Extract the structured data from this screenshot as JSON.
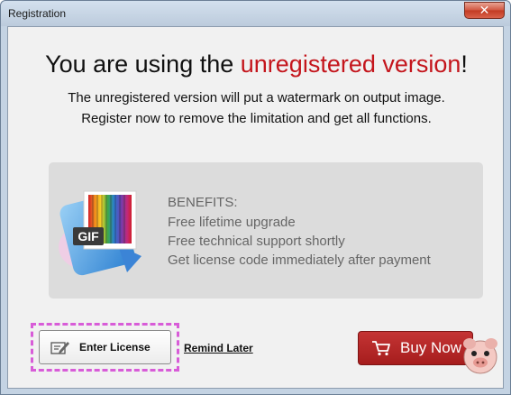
{
  "window": {
    "title": "Registration",
    "close_glyph": "✕"
  },
  "headline": {
    "prefix": "You are using the ",
    "highlight": "unregistered version",
    "suffix": "!"
  },
  "description": {
    "line1": "The unregistered version will put a watermark on output image.",
    "line2": "Register now to remove the limitation and get all functions."
  },
  "benefits": {
    "heading": "BENEFITS:",
    "items": [
      "Free lifetime upgrade",
      "Free technical support shortly",
      "Get license code immediately after payment"
    ],
    "icon_badge": "GIF",
    "icon": "gif-app-icon"
  },
  "actions": {
    "enter_license_label": "Enter License",
    "enter_license_icon": "pen-icon",
    "remind_later_label": "Remind Later",
    "buy_now_label": "Buy Now",
    "buy_now_icon": "cart-icon"
  },
  "colors": {
    "highlight_red": "#c4151c",
    "buy_button": "#b52626",
    "focus_dash": "#d85cd8"
  }
}
